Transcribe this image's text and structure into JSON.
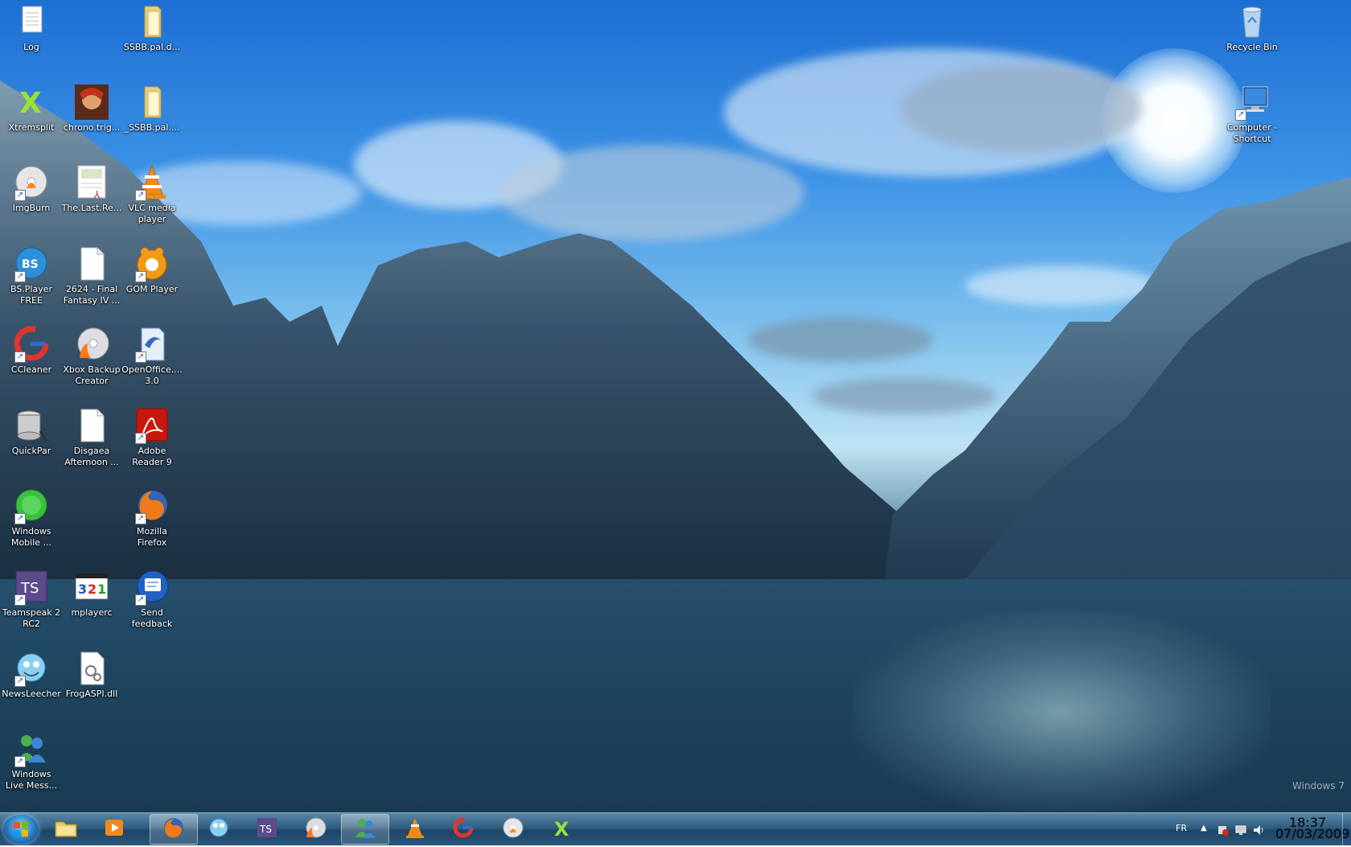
{
  "desktop_icons": [
    {
      "label": "Log"
    },
    {
      "label": "SSBB.pal.d..."
    },
    {
      "label": "Xtremsplit"
    },
    {
      "label": "chrono.trig..."
    },
    {
      "label": "_SSBB.pal...."
    },
    {
      "label": "ImgBurn"
    },
    {
      "label": "The.Last.Re..."
    },
    {
      "label": "VLC media\nplayer"
    },
    {
      "label": "BS.Player\nFREE"
    },
    {
      "label": "2624 - Final\nFantasy IV ..."
    },
    {
      "label": "GOM Player"
    },
    {
      "label": "CCleaner"
    },
    {
      "label": "Xbox Backup\nCreator"
    },
    {
      "label": "OpenOffice....\n3.0"
    },
    {
      "label": "QuickPar"
    },
    {
      "label": "Disgaea\nAfternoon ..."
    },
    {
      "label": "Adobe\nReader 9"
    },
    {
      "label": "Windows\nMobile ..."
    },
    {
      "label": "Mozilla\nFirefox"
    },
    {
      "label": "Teamspeak 2\nRC2"
    },
    {
      "label": "mplayerc"
    },
    {
      "label": "Send\nfeedback"
    },
    {
      "label": "NewsLeecher"
    },
    {
      "label": "FrogASPI.dll"
    },
    {
      "label": "Windows\nLive Mess..."
    },
    {
      "label": "Recycle Bin"
    },
    {
      "label": "Computer -\nShortcut"
    }
  ],
  "watermark": "Windows 7",
  "taskbar": {
    "pinned": [
      {
        "icon": "explorer-icon"
      },
      {
        "icon": "media-player-icon"
      },
      {
        "icon": "firefox-icon"
      },
      {
        "icon": "newsleecher-icon"
      },
      {
        "icon": "teamspeak-icon"
      },
      {
        "icon": "burn-disc-icon"
      },
      {
        "icon": "messenger-icon"
      },
      {
        "icon": "vlc-icon"
      },
      {
        "icon": "ccleaner-icon"
      },
      {
        "icon": "imgburn-icon"
      },
      {
        "icon": "xtremsplit-icon"
      }
    ]
  },
  "tray": {
    "language": "FR",
    "time": "18:37",
    "date": "07/03/2009"
  },
  "colors": {
    "taskbar": "#2f5d80",
    "sky": "#3d93e6"
  }
}
